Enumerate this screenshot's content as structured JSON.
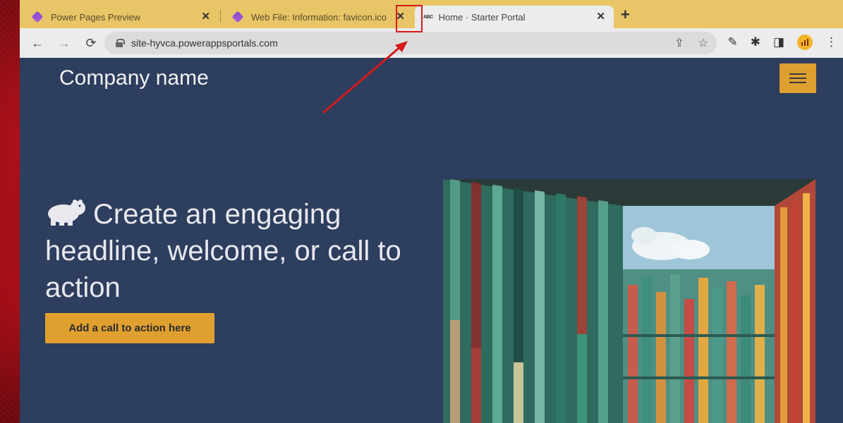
{
  "browser": {
    "tabs": [
      {
        "title": "Power Pages Preview",
        "close": "✕"
      },
      {
        "title": "Web File: Information: favicon.ico",
        "close": "✕"
      },
      {
        "favicon_text": "ABC",
        "title": "Home · Starter Portal",
        "close": "✕"
      }
    ],
    "new_tab": "+",
    "url": "site-hyvca.powerappsportals.com",
    "icons": {
      "back": "←",
      "forward": "→",
      "reload": "⟳",
      "share": "⇪",
      "bookmark": "☆",
      "eyedropper": "✎",
      "extensions": "✱",
      "sidepanel": "◨",
      "more": "⋮"
    }
  },
  "page": {
    "company_name": "Company name",
    "headline": "Create an engaging headline, welcome, or call to action",
    "cta_label": "Add a call to action here"
  },
  "colors": {
    "accent": "#e0a030",
    "page_background": "#2d3e5e",
    "tab_strip": "#e8c567",
    "annotation": "#d41a1a"
  }
}
